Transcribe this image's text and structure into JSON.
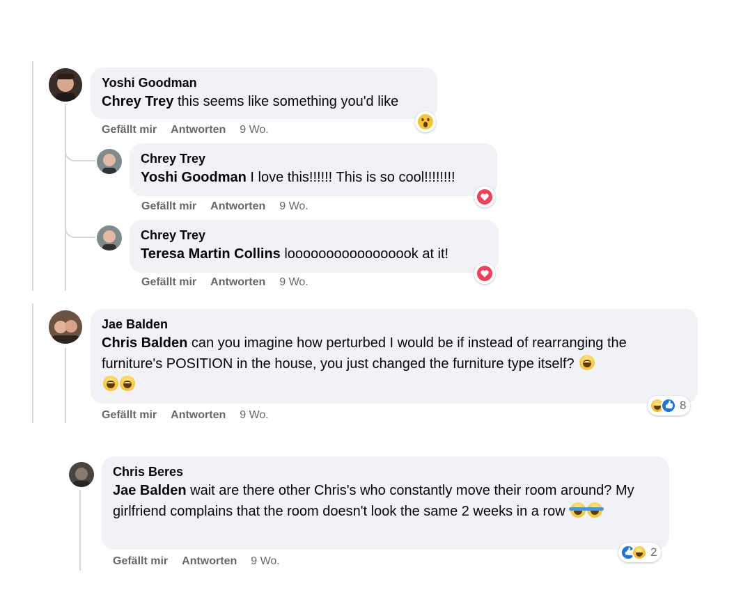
{
  "comments": [
    {
      "author": "Yoshi Goodman",
      "mention": "Chrey Trey",
      "text": " this seems like something you'd like",
      "actions": {
        "like": "Gefällt mir",
        "reply": "Antworten",
        "time": "9 Wo."
      },
      "reaction": "wow-icon"
    },
    {
      "author": "Chrey Trey",
      "mention": "Yoshi Goodman",
      "text": " I love this!!!!!! This is so cool!!!!!!!!",
      "actions": {
        "like": "Gefällt mir",
        "reply": "Antworten",
        "time": "9 Wo."
      },
      "reaction": "love-icon"
    },
    {
      "author": "Chrey Trey",
      "mention": "Teresa Martin Collins",
      "text": " looooooooooooooook at it!",
      "actions": {
        "like": "Gefällt mir",
        "reply": "Antworten",
        "time": "9 Wo."
      },
      "reaction": "love-icon"
    },
    {
      "author": "Jae Balden",
      "mention": "Chris Balden",
      "text": " can you imagine how perturbed I would be if instead of rearranging the furniture's POSITION in the house, you just changed the furniture type itself?",
      "actions": {
        "like": "Gefällt mir",
        "reply": "Antworten",
        "time": "9 Wo."
      },
      "reaction_count": "8",
      "reactions": [
        "haha-icon",
        "like-icon"
      ]
    },
    {
      "author": "Chris Beres",
      "mention": "Jae Balden",
      "text": " wait are there other Chris's who constantly move their room around? My girlfriend complains that the room doesn't look the same 2 weeks in a row",
      "actions": {
        "like": "Gefällt mir",
        "reply": "Antworten",
        "time": "9 Wo."
      },
      "reaction_count": "2",
      "reactions": [
        "like-icon",
        "haha-icon"
      ]
    }
  ],
  "colors": {
    "bubble": "#f0f2f5",
    "meta_text": "#65676b",
    "thread_line": "#d3d6db",
    "love": "#f33e58",
    "like": "#1b74e4",
    "haha": "#f7c433"
  }
}
